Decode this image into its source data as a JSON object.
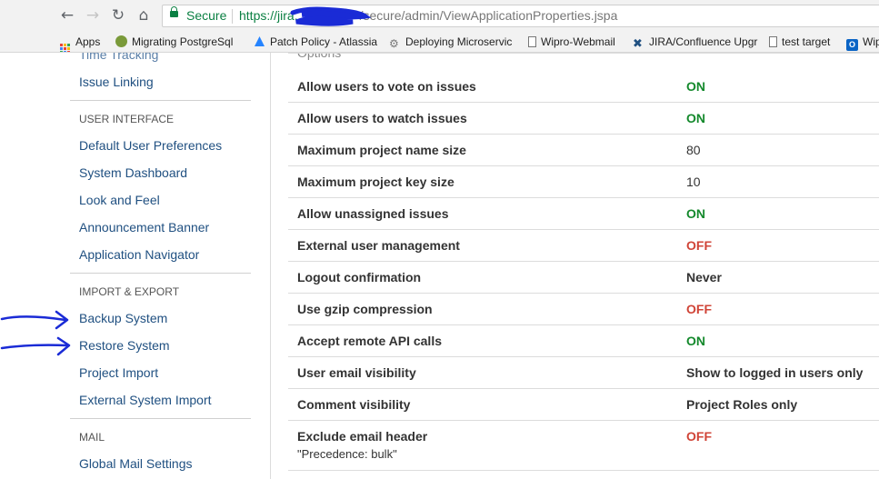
{
  "browser": {
    "back_icon": "←",
    "forward_icon": "→",
    "reload_icon": "↻",
    "home_icon": "⌂",
    "secure_label": "Secure",
    "url_scheme": "https://jira.",
    "url_path": "/secure/admin/ViewApplicationProperties.jspa"
  },
  "bookmarks": [
    {
      "label": "Apps",
      "icon": "apps-grid-icon"
    },
    {
      "label": "Migrating PostgreSql",
      "icon": "elephant-icon"
    },
    {
      "label": "Patch Policy - Atlassia",
      "icon": "atlassian-icon"
    },
    {
      "label": "Deploying Microservic",
      "icon": "gear-icon"
    },
    {
      "label": "Wipro-Webmail",
      "icon": "page-icon"
    },
    {
      "label": "JIRA/Confluence Upgr",
      "icon": "x-logo-icon"
    },
    {
      "label": "test target",
      "icon": "page-icon"
    },
    {
      "label": "Wip",
      "icon": "outlook-icon"
    }
  ],
  "sidebar": {
    "time_tracking": "Time Tracking",
    "issue_linking": "Issue Linking",
    "ui_heading": "USER INTERFACE",
    "ui_items": [
      "Default User Preferences",
      "System Dashboard",
      "Look and Feel",
      "Announcement Banner",
      "Application Navigator"
    ],
    "ie_heading": "IMPORT & EXPORT",
    "ie_items": [
      "Backup System",
      "Restore System",
      "Project Import",
      "External System Import"
    ],
    "mail_heading": "MAIL",
    "mail_items": [
      "Global Mail Settings"
    ]
  },
  "main": {
    "section_title": "Options",
    "rows": [
      {
        "label": "Allow users to vote on issues",
        "value": "ON",
        "state": "on"
      },
      {
        "label": "Allow users to watch issues",
        "value": "ON",
        "state": "on"
      },
      {
        "label": "Maximum project name size",
        "value": "80",
        "state": "plain"
      },
      {
        "label": "Maximum project key size",
        "value": "10",
        "state": "plain"
      },
      {
        "label": "Allow unassigned issues",
        "value": "ON",
        "state": "on"
      },
      {
        "label": "External user management",
        "value": "OFF",
        "state": "off"
      },
      {
        "label": "Logout confirmation",
        "value": "Never",
        "state": "bold"
      },
      {
        "label": "Use gzip compression",
        "value": "OFF",
        "state": "off"
      },
      {
        "label": "Accept remote API calls",
        "value": "ON",
        "state": "on"
      },
      {
        "label": "User email visibility",
        "value": "Show to logged in users only",
        "state": "bold"
      },
      {
        "label": "Comment visibility",
        "value": "Project Roles only",
        "state": "bold"
      },
      {
        "label": "Exclude email header",
        "sublabel": "\"Precedence: bulk\"",
        "value": "OFF",
        "state": "off"
      }
    ]
  },
  "colors": {
    "link": "#205081",
    "on": "#14892c",
    "off": "#d04437",
    "annotation": "#1a2bd6"
  }
}
